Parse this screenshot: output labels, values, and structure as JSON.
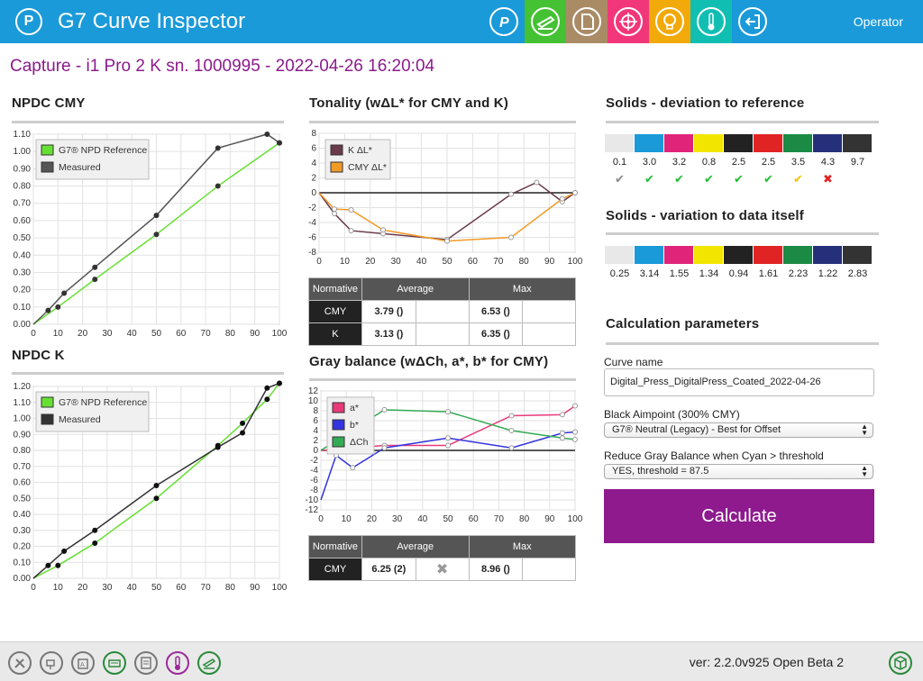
{
  "header": {
    "title": "G7 Curve Inspector",
    "operator": "Operator",
    "toolbar": [
      {
        "icon": "p-logo-icon",
        "color": "#1a9ad9"
      },
      {
        "icon": "ink-sensor-icon",
        "color": "#44c233"
      },
      {
        "icon": "document-icon",
        "color": "#a98b66"
      },
      {
        "icon": "target-icon",
        "color": "#f2367a"
      },
      {
        "icon": "lightbulb-icon",
        "color": "#f2a90a"
      },
      {
        "icon": "thermometer-icon",
        "color": "#11bfb2"
      },
      {
        "icon": "logout-icon",
        "color": "#1a9ad9"
      }
    ]
  },
  "capture": "Capture - i1 Pro 2 K sn. 1000995 - 2022-04-26 16:20:04",
  "sections": {
    "npdc_cmy": "NPDC CMY",
    "npdc_k": "NPDC K",
    "tonality": "Tonality (wΔL* for CMY and K)",
    "gray_balance": "Gray balance (wΔCh, a*, b* for CMY)",
    "solids_ref": "Solids - deviation to reference",
    "solids_var": "Solids - variation to data itself",
    "calc_params": "Calculation parameters"
  },
  "chart_data": [
    {
      "type": "line",
      "title": "NPDC CMY",
      "x": [
        0,
        6,
        12.5,
        25,
        50,
        75,
        95,
        100
      ],
      "xlim": [
        0,
        100
      ],
      "ylim": [
        0,
        1.1
      ],
      "legend": "top-left",
      "series": [
        {
          "name": "G7® NPD Reference",
          "color": "#66e033",
          "x": [
            0,
            10,
            25,
            50,
            75,
            100
          ],
          "values": [
            0,
            0.1,
            0.26,
            0.52,
            0.8,
            1.05
          ]
        },
        {
          "name": "Measured",
          "color": "#555555",
          "values": [
            0,
            0.08,
            0.18,
            0.33,
            0.63,
            1.02,
            1.1,
            1.05
          ]
        }
      ]
    },
    {
      "type": "line",
      "title": "NPDC K",
      "x": [
        0,
        6,
        12.5,
        25,
        50,
        75,
        85,
        95,
        100
      ],
      "xlim": [
        0,
        100
      ],
      "ylim": [
        0,
        1.2
      ],
      "legend": "top-left",
      "series": [
        {
          "name": "G7® NPD Reference",
          "color": "#66e033",
          "x": [
            0,
            10,
            25,
            50,
            75,
            85,
            95,
            100
          ],
          "values": [
            0,
            0.08,
            0.22,
            0.5,
            0.83,
            0.97,
            1.12,
            1.22
          ]
        },
        {
          "name": "Measured",
          "color": "#333333",
          "values": [
            0,
            0.08,
            0.17,
            0.3,
            0.58,
            0.82,
            0.91,
            1.19,
            1.22
          ]
        }
      ]
    },
    {
      "type": "line",
      "title": "Tonality (wΔL* for CMY and K)",
      "xlim": [
        0,
        100
      ],
      "ylim": [
        -8,
        8
      ],
      "legend": "top-left",
      "series": [
        {
          "name": "K ΔL*",
          "color": "#6b3a4b",
          "x": [
            0,
            6,
            12.5,
            25,
            50,
            75,
            85,
            95,
            100
          ],
          "values": [
            0,
            -2.8,
            -5.1,
            -5.5,
            -6.3,
            -0.2,
            1.4,
            -1.2,
            0
          ]
        },
        {
          "name": "CMY ΔL*",
          "color": "#f29a26",
          "x": [
            0,
            6,
            12.5,
            25,
            50,
            75,
            95,
            100
          ],
          "values": [
            0,
            -2.2,
            -2.3,
            -5.0,
            -6.5,
            -6.0,
            -0.8,
            0
          ]
        }
      ]
    },
    {
      "type": "line",
      "title": "Gray balance (wΔCh, a*, b* for CMY)",
      "xlim": [
        0,
        100
      ],
      "ylim": [
        -12,
        12
      ],
      "legend": "top-left",
      "series": [
        {
          "name": "a*",
          "color": "#e83a7a",
          "x": [
            0,
            25,
            50,
            75,
            95,
            100
          ],
          "values": [
            0,
            1,
            1,
            7,
            7.2,
            9
          ]
        },
        {
          "name": "b*",
          "color": "#3333e0",
          "x": [
            0,
            6,
            12.5,
            25,
            50,
            75,
            95,
            100
          ],
          "values": [
            -10,
            -1,
            -3.5,
            0.5,
            2.5,
            0.5,
            3.5,
            3.7
          ]
        },
        {
          "name": "ΔCh",
          "color": "#33aa55",
          "x": [
            0,
            25,
            50,
            75,
            95,
            100
          ],
          "values": [
            0,
            8.2,
            7.8,
            4,
            2.5,
            2.2
          ]
        }
      ]
    }
  ],
  "tonality_table": {
    "headers": [
      "Normative",
      "Average",
      "Max"
    ],
    "rows": [
      {
        "label": "CMY",
        "average": "3.79 ()",
        "max": "6.53 ()"
      },
      {
        "label": "K",
        "average": "3.13 ()",
        "max": "6.35 ()"
      }
    ]
  },
  "gray_table": {
    "headers": [
      "Normative",
      "Average",
      "Max"
    ],
    "rows": [
      {
        "label": "CMY",
        "average": "6.25 (2)",
        "status": "✖",
        "max": "8.96 ()"
      }
    ]
  },
  "solids_deviation": [
    {
      "color": "#e8e8e8",
      "value": "0.1",
      "status": "✔",
      "status_color": "#888888"
    },
    {
      "color": "#1a9ad9",
      "value": "3.0",
      "status": "✔",
      "status_color": "#22bb33"
    },
    {
      "color": "#e0247a",
      "value": "3.2",
      "status": "✔",
      "status_color": "#22bb33"
    },
    {
      "color": "#f2e500",
      "value": "0.8",
      "status": "✔",
      "status_color": "#22bb33"
    },
    {
      "color": "#222222",
      "value": "2.5",
      "status": "✔",
      "status_color": "#22bb33"
    },
    {
      "color": "#e02424",
      "value": "2.5",
      "status": "✔",
      "status_color": "#22bb33"
    },
    {
      "color": "#1a8a44",
      "value": "3.5",
      "status": "✔",
      "status_color": "#f2c200"
    },
    {
      "color": "#26307a",
      "value": "4.3",
      "status": "✖",
      "status_color": "#e02424"
    },
    {
      "color": "#333333",
      "value": "9.7",
      "status": "",
      "status_color": "#ffffff"
    }
  ],
  "solids_variation": [
    {
      "color": "#e8e8e8",
      "value": "0.25"
    },
    {
      "color": "#1a9ad9",
      "value": "3.14"
    },
    {
      "color": "#e0247a",
      "value": "1.55"
    },
    {
      "color": "#f2e500",
      "value": "1.34"
    },
    {
      "color": "#222222",
      "value": "0.94"
    },
    {
      "color": "#e02424",
      "value": "1.61"
    },
    {
      "color": "#1a8a44",
      "value": "2.23"
    },
    {
      "color": "#26307a",
      "value": "1.22"
    },
    {
      "color": "#333333",
      "value": "2.83"
    }
  ],
  "params": {
    "curve_name_label": "Curve name",
    "curve_name_value": "Digital_Press_DigitalPress_Coated_2022-04-26",
    "black_aimpoint_label": "Black Aimpoint (300% CMY)",
    "black_aimpoint_value": "G7® Neutral (Legacy) - Best for Offset",
    "reduce_gray_label": "Reduce Gray Balance when Cyan > threshold",
    "reduce_gray_value": "YES, threshold = 87.5",
    "calculate": "Calculate"
  },
  "footer": {
    "version": "ver: 2.2.0v925 Open Beta 2",
    "buttons": [
      "tools-icon",
      "spray-icon",
      "wifi-doc-icon",
      "printer-icon",
      "list-doc-icon",
      "thermometer-icon",
      "ink-sensor-icon",
      "cube-icon"
    ]
  }
}
